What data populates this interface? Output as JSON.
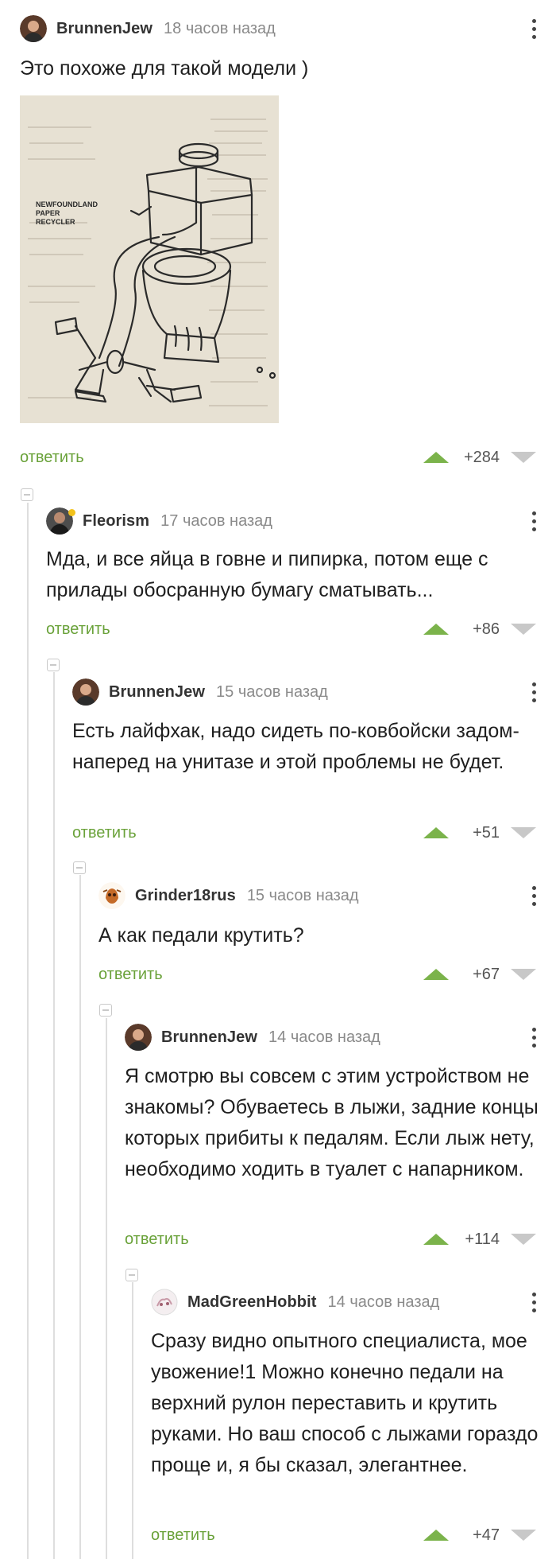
{
  "comments": [
    {
      "author": "BrunnenJew",
      "time": "18 часов назад",
      "text": "Это похоже для такой модели )",
      "reply_label": "ответить",
      "score": "+284",
      "image_text": "NEWFOUNDLAND\nPAPER\nRECYCLER"
    },
    {
      "author": "Fleorism",
      "time": "17 часов назад",
      "text": "Мда, и все яйца в говне и пипирка, потом еще с прилады обосранную бумагу сматывать...",
      "reply_label": "ответить",
      "score": "+86"
    },
    {
      "author": "BrunnenJew",
      "time": "15 часов назад",
      "text": "Есть лайфхак, надо сидеть по-ковбойски задом-наперед на унитазе и этой проблемы не будет.",
      "reply_label": "ответить",
      "score": "+51"
    },
    {
      "author": "Grinder18rus",
      "time": "15 часов назад",
      "text": "А как педали крутить?",
      "reply_label": "ответить",
      "score": "+67"
    },
    {
      "author": "BrunnenJew",
      "time": "14 часов назад",
      "text": "Я смотрю вы совсем с этим устройством не знакомы? Обуваетесь в лыжи, задние концы которых прибиты к педалям. Если лыж нету, необходимо ходить в туалет с напарником.",
      "reply_label": "ответить",
      "score": "+114"
    },
    {
      "author": "MadGreenHobbit",
      "time": "14 часов назад",
      "text": "Сразу видно опытного специалиста, мое увожение!1 Можно конечно педали на верхний рулон переставить и крутить руками. Но ваш способ с лыжами гораздо проще и, я бы сказал, элегантнее.",
      "reply_label": "ответить",
      "score": "+47"
    }
  ],
  "colors": {
    "reply": "#6aa23a",
    "upvote": "#7bb34b",
    "downvote": "#c8c8c8",
    "time": "#8a8a8a"
  }
}
